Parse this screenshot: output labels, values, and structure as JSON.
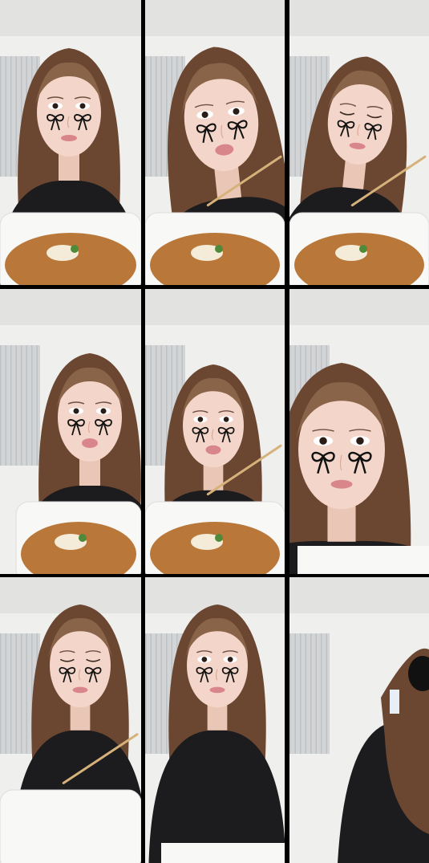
{
  "grid": {
    "rows": 3,
    "columns": 3
  },
  "colors": {
    "divider": "#000000",
    "wall": "#efefed",
    "blinds": "#d2d4d6",
    "hair": "#6b4631",
    "hair_light": "#8a6448",
    "skin": "#f3d6c9",
    "shirt": "#1c1c1e",
    "bowl": "#f8f8f6",
    "katsu": "#b9783a",
    "bow": "#111111",
    "chopstick": "#d6b27a"
  },
  "frames": [
    {
      "subject": "face-front",
      "bows": true,
      "food": "katsudon-bowl",
      "chopsticks": false
    },
    {
      "subject": "eating",
      "bows": true,
      "food": "katsudon-bowl",
      "chopsticks": true
    },
    {
      "subject": "eyes-closed",
      "bows": true,
      "food": "katsudon-bowl",
      "chopsticks": true
    },
    {
      "subject": "talking",
      "bows": true,
      "food": "katsudon-bowl",
      "chopsticks": false
    },
    {
      "subject": "talking",
      "bows": true,
      "food": "katsudon-bowl",
      "chopsticks": true
    },
    {
      "subject": "close-up",
      "bows": true,
      "food": "tray",
      "chopsticks": false
    },
    {
      "subject": "eyes-closed",
      "bows": true,
      "food": "empty-bowl",
      "chopsticks": true
    },
    {
      "subject": "standing",
      "bows": true,
      "food": "none",
      "chopsticks": false
    },
    {
      "subject": "leaving",
      "bows": false,
      "food": "none",
      "chopsticks": false
    }
  ]
}
